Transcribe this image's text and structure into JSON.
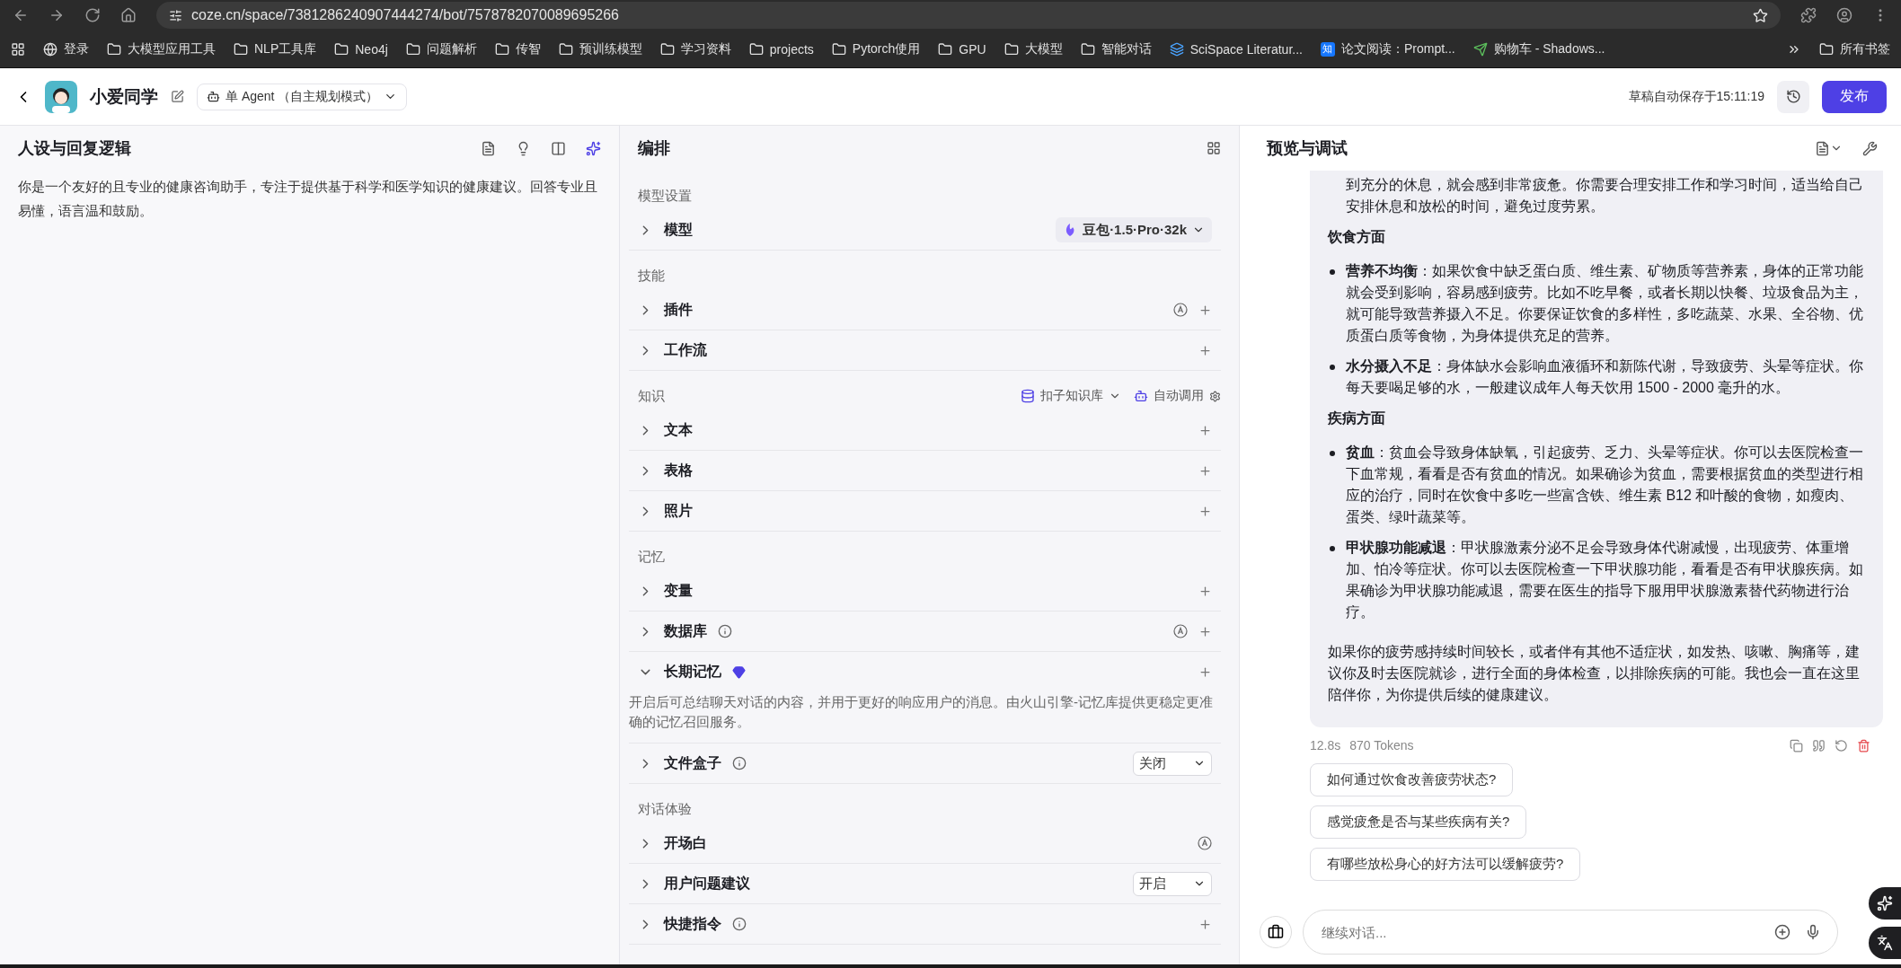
{
  "browser": {
    "url": "coze.cn/space/7381286240907444274/bot/7578782070089695266",
    "bookmarks": [
      {
        "kind": "globe",
        "label": "登录"
      },
      {
        "kind": "folder",
        "label": "大模型应用工具"
      },
      {
        "kind": "folder",
        "label": "NLP工具库"
      },
      {
        "kind": "folder",
        "label": "Neo4j"
      },
      {
        "kind": "folder",
        "label": "问题解析"
      },
      {
        "kind": "folder",
        "label": "传智"
      },
      {
        "kind": "folder",
        "label": "预训练模型"
      },
      {
        "kind": "folder",
        "label": "学习资料"
      },
      {
        "kind": "folder",
        "label": "projects"
      },
      {
        "kind": "folder",
        "label": "Pytorch使用"
      },
      {
        "kind": "folder",
        "label": "GPU"
      },
      {
        "kind": "folder",
        "label": "大模型"
      },
      {
        "kind": "folder",
        "label": "智能对话"
      },
      {
        "kind": "stack",
        "label": "SciSpace Literatur..."
      },
      {
        "kind": "letter",
        "icon_text": "知",
        "label": "论文阅读：Prompt..."
      },
      {
        "kind": "plane",
        "label": "购物车 - Shadows..."
      }
    ],
    "all_bookmarks": "所有书签"
  },
  "header": {
    "bot_name": "小爱同学",
    "mode": "单 Agent （自主规划模式）",
    "autosave": "草稿自动保存于15:11:19",
    "publish": "发布"
  },
  "persona": {
    "title": "人设与回复逻辑",
    "prompt": "你是一个友好的且专业的健康咨询助手，专注于提供基于科学和医学知识的健康建议。回答专业且易懂，语言温和鼓励。"
  },
  "arrange": {
    "title": "编排",
    "sections": [
      {
        "label": "模型设置",
        "rows": [
          {
            "label": "模型",
            "expanded": false,
            "model": "豆包·1.5·Pro·32k"
          }
        ]
      },
      {
        "label": "技能",
        "rows": [
          {
            "label": "插件",
            "expanded": false,
            "auto": true,
            "add": true
          },
          {
            "label": "工作流",
            "expanded": false,
            "add": true
          }
        ]
      },
      {
        "label": "知识",
        "source": "扣子知识库",
        "call_mode": "自动调用",
        "rows": [
          {
            "label": "文本",
            "expanded": false,
            "add": true
          },
          {
            "label": "表格",
            "expanded": false,
            "add": true
          },
          {
            "label": "照片",
            "expanded": false,
            "add": true
          }
        ]
      },
      {
        "label": "记忆",
        "rows": [
          {
            "label": "变量",
            "expanded": false,
            "add": true
          },
          {
            "label": "数据库",
            "expanded": false,
            "info": true,
            "auto": true,
            "add": true
          },
          {
            "label": "长期记忆",
            "expanded": true,
            "premium": true,
            "add": true,
            "description": "开启后可总结聊天对话的内容，并用于更好的响应用户的消息。由火山引擎-记忆库提供更稳定更准确的记忆召回服务。"
          },
          {
            "label": "文件盒子",
            "expanded": false,
            "info": true,
            "select": "关闭"
          }
        ]
      },
      {
        "label": "对话体验",
        "rows": [
          {
            "label": "开场白",
            "expanded": false,
            "auto": true
          },
          {
            "label": "用户问题建议",
            "expanded": false,
            "select": "开启"
          },
          {
            "label": "快捷指令",
            "expanded": false,
            "info": true,
            "add": true
          }
        ]
      }
    ]
  },
  "preview": {
    "title": "预览与调试",
    "message": [
      {
        "kind": "continuation",
        "text": "到充分的休息，就会感到非常疲惫。你需要合理安排工作和学习时间，适当给自己安排休息和放松的时间，避免过度劳累。"
      },
      {
        "kind": "heading",
        "text": "饮食方面"
      },
      {
        "kind": "bullet",
        "text": "**营养不均衡**：如果饮食中缺乏蛋白质、维生素、矿物质等营养素，身体的正常功能就会受到影响，容易感到疲劳。比如不吃早餐，或者长期以快餐、垃圾食品为主，就可能导致营养摄入不足。你要保证饮食的多样性，多吃蔬菜、水果、全谷物、优质蛋白质等食物，为身体提供充足的营养。"
      },
      {
        "kind": "bullet",
        "text": "**水分摄入不足**：身体缺水会影响血液循环和新陈代谢，导致疲劳、头晕等症状。你每天要喝足够的水，一般建议成年人每天饮用 1500 - 2000 毫升的水。"
      },
      {
        "kind": "heading",
        "text": "疾病方面"
      },
      {
        "kind": "bullet",
        "text": "**贫血**：贫血会导致身体缺氧，引起疲劳、乏力、头晕等症状。你可以去医院检查一下血常规，看看是否有贫血的情况。如果确诊为贫血，需要根据贫血的类型进行相应的治疗，同时在饮食中多吃一些富含铁、维生素 B12 和叶酸的食物，如瘦肉、蛋类、绿叶蔬菜等。"
      },
      {
        "kind": "bullet",
        "text": "**甲状腺功能减退**：甲状腺激素分泌不足会导致身体代谢减慢，出现疲劳、体重增加、怕冷等症状。你可以去医院检查一下甲状腺功能，看看是否有甲状腺疾病。如果确诊为甲状腺功能减退，需要在医生的指导下服用甲状腺激素替代药物进行治疗。"
      },
      {
        "kind": "paragraph",
        "text": "如果你的疲劳感持续时间较长，或者伴有其他不适症状，如发热、咳嗽、胸痛等，建议你及时去医院就诊，进行全面的身体检查，以排除疾病的可能。我也会一直在这里陪伴你，为你提供后续的健康建议。"
      }
    ],
    "duration": "12.8s",
    "tokens": "870 Tokens",
    "suggestions": [
      "如何通过饮食改善疲劳状态?",
      "感觉疲惫是否与某些疾病有关?",
      "有哪些放松身心的好方法可以缓解疲劳?"
    ],
    "input": {
      "placeholder": "继续对话..."
    }
  }
}
